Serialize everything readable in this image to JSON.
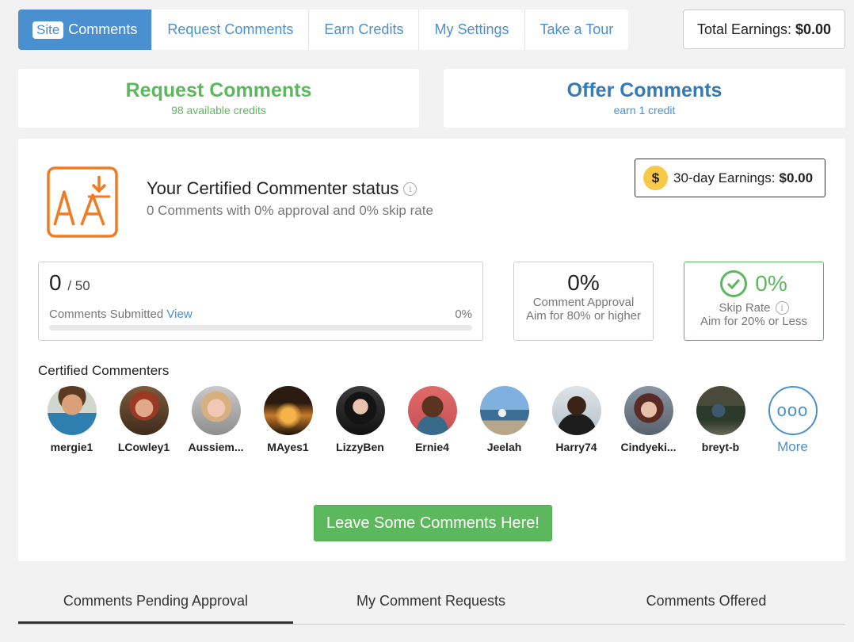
{
  "nav": {
    "tabs": [
      {
        "badge": "Site",
        "label": "Comments"
      },
      {
        "label": "Request Comments"
      },
      {
        "label": "Earn Credits"
      },
      {
        "label": "My Settings"
      },
      {
        "label": "Take a Tour"
      }
    ],
    "total_earnings_label": "Total Earnings:",
    "total_earnings_value": "$0.00"
  },
  "actions": {
    "request": {
      "title": "Request Comments",
      "subtitle": "98 available credits"
    },
    "offer": {
      "title": "Offer Comments",
      "subtitle": "earn 1 credit"
    }
  },
  "status": {
    "title": "Your Certified Commenter status",
    "info_glyph": "i",
    "subtitle": "0 Comments with 0% approval and 0% skip rate",
    "earnings_label": "30-day Earnings:",
    "earnings_value": "$0.00",
    "coin_glyph": "$"
  },
  "progress": {
    "count": "0",
    "goal": "/ 50",
    "label": "Comments Submitted",
    "view_link": "View",
    "percent": "0%",
    "fill_fraction": 0
  },
  "approval": {
    "value": "0%",
    "label": "Comment Approval",
    "hint": "Aim for 80% or higher"
  },
  "skip": {
    "value": "0%",
    "label": "Skip Rate",
    "hint": "Aim for 20% or Less"
  },
  "certified": {
    "title": "Certified Commenters",
    "people": [
      {
        "name": "mergie1"
      },
      {
        "name": "LCowley1"
      },
      {
        "name": "Aussiem..."
      },
      {
        "name": "MAyes1"
      },
      {
        "name": "LizzyBen"
      },
      {
        "name": "Ernie4"
      },
      {
        "name": "Jeelah"
      },
      {
        "name": "Harry74"
      },
      {
        "name": "Cindyeki..."
      },
      {
        "name": "breyt-b"
      }
    ],
    "more_label": "More",
    "more_glyph": "ooo"
  },
  "cta": {
    "label": "Leave Some Comments Here!"
  },
  "bottom_tabs": [
    {
      "label": "Comments Pending Approval"
    },
    {
      "label": "My Comment Requests"
    },
    {
      "label": "Comments Offered"
    }
  ],
  "colors": {
    "accent": "#4a8fcf",
    "success": "#5cb85c",
    "logo": "#f07b22",
    "coin": "#f7c948"
  }
}
